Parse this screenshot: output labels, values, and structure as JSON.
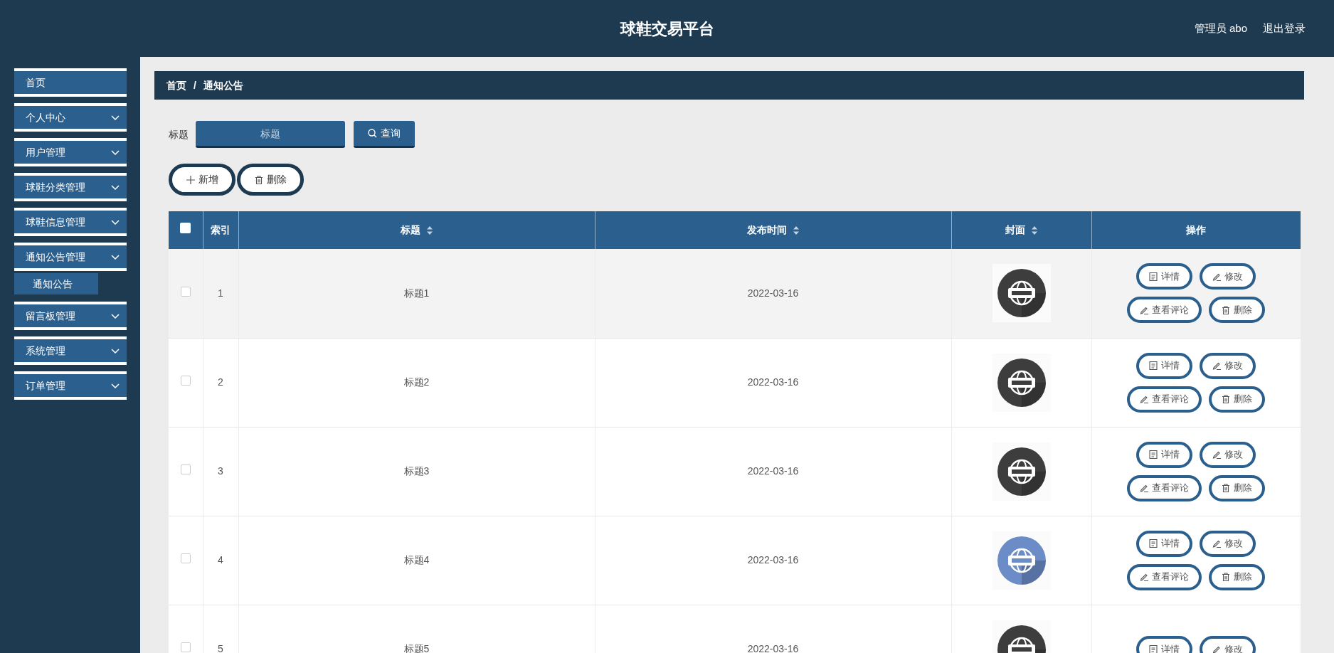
{
  "header": {
    "title": "球鞋交易平台",
    "user": "管理员 abo",
    "logout": "退出登录"
  },
  "sidebar": {
    "items": [
      {
        "label": "首页",
        "kind": "link"
      },
      {
        "label": "个人中心",
        "kind": "submenu"
      },
      {
        "label": "用户管理",
        "kind": "submenu"
      },
      {
        "label": "球鞋分类管理",
        "kind": "submenu"
      },
      {
        "label": "球鞋信息管理",
        "kind": "submenu"
      },
      {
        "label": "通知公告管理",
        "kind": "submenu",
        "children": [
          {
            "label": "通知公告"
          }
        ]
      },
      {
        "label": "留言板管理",
        "kind": "submenu"
      },
      {
        "label": "系统管理",
        "kind": "submenu"
      },
      {
        "label": "订单管理",
        "kind": "submenu"
      }
    ]
  },
  "breadcrumb": {
    "items": [
      "首页",
      "通知公告"
    ],
    "separator": "/"
  },
  "search": {
    "label": "标题",
    "placeholder": "标题",
    "button": "查询"
  },
  "toolbar": [
    {
      "label": "新增",
      "kind": "add"
    },
    {
      "label": "删除",
      "kind": "delete"
    }
  ],
  "table": {
    "select_all": {
      "checked": false
    },
    "columns": [
      {
        "label": "索引",
        "sortable": false
      },
      {
        "label": "标题",
        "sortable": true
      },
      {
        "label": "发布时间",
        "sortable": true
      },
      {
        "label": "封面",
        "sortable": true
      },
      {
        "label": "操作",
        "sortable": false
      }
    ],
    "rows": [
      {
        "checked": false,
        "highlighted": true,
        "index": "1",
        "title": "标题1",
        "date": "2022-03-16",
        "cover": {
          "kind": "picture",
          "color": "#3d3d3d"
        },
        "actions": [
          {
            "label": "详情",
            "kind": "detail"
          },
          {
            "label": "修改",
            "kind": "edit"
          },
          {
            "label": "查看评论",
            "kind": "edit"
          },
          {
            "label": "删除",
            "kind": "delete"
          }
        ]
      },
      {
        "checked": false,
        "highlighted": false,
        "index": "2",
        "title": "标题2",
        "date": "2022-03-16",
        "cover": {
          "kind": "picture",
          "color": "#3d3d3d"
        },
        "actions": [
          {
            "label": "详情",
            "kind": "detail"
          },
          {
            "label": "修改",
            "kind": "edit"
          },
          {
            "label": "查看评论",
            "kind": "edit"
          },
          {
            "label": "删除",
            "kind": "delete"
          }
        ]
      },
      {
        "checked": false,
        "highlighted": false,
        "index": "3",
        "title": "标题3",
        "date": "2022-03-16",
        "cover": {
          "kind": "picture",
          "color": "#3d3d3d"
        },
        "actions": [
          {
            "label": "详情",
            "kind": "detail"
          },
          {
            "label": "修改",
            "kind": "edit"
          },
          {
            "label": "查看评论",
            "kind": "edit"
          },
          {
            "label": "删除",
            "kind": "delete"
          }
        ]
      },
      {
        "checked": false,
        "highlighted": false,
        "index": "4",
        "title": "标题4",
        "date": "2022-03-16",
        "cover": {
          "kind": "picture",
          "color": "#6b8cc6"
        },
        "actions": [
          {
            "label": "详情",
            "kind": "detail"
          },
          {
            "label": "修改",
            "kind": "edit"
          },
          {
            "label": "查看评论",
            "kind": "edit"
          },
          {
            "label": "删除",
            "kind": "delete"
          }
        ]
      },
      {
        "checked": false,
        "highlighted": false,
        "index": "5",
        "title": "标题5",
        "date": "2022-03-16",
        "cover": {
          "kind": "picture",
          "color": "#3d3d3d"
        },
        "actions": [
          {
            "label": "详情",
            "kind": "detail"
          },
          {
            "label": "修改",
            "kind": "edit"
          }
        ]
      }
    ]
  }
}
